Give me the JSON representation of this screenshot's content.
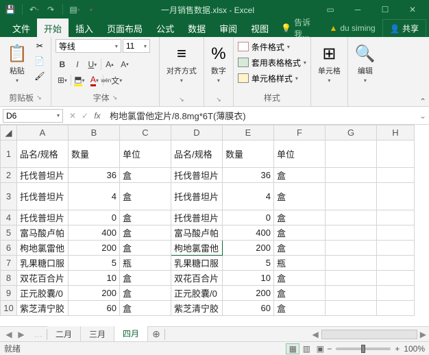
{
  "title": "一月销售数据.xlsx - Excel",
  "tabs": [
    "文件",
    "开始",
    "插入",
    "页面布局",
    "公式",
    "数据",
    "审阅",
    "视图"
  ],
  "tellme": "告诉我...",
  "user": "du siming",
  "share": "共享",
  "ribbon": {
    "clipboard": {
      "paste": "粘贴",
      "label": "剪贴板"
    },
    "font": {
      "name": "等线",
      "size": "11",
      "label": "字体"
    },
    "align": {
      "label": "对齐方式"
    },
    "number": {
      "label": "数字",
      "pct": "%"
    },
    "styles": {
      "cond": "条件格式",
      "table": "套用表格格式",
      "cell": "单元格样式",
      "label": "样式"
    },
    "cells": {
      "label": "单元格"
    },
    "editing": {
      "label": "编辑"
    }
  },
  "namebox": "D6",
  "formula": "枸地氯雷他定片/8.8mg*6T(薄膜衣)",
  "cols": [
    "A",
    "B",
    "C",
    "D",
    "E",
    "F",
    "G",
    "H"
  ],
  "headers": {
    "name": "品名/规格",
    "qty": "数量",
    "unit": "单位"
  },
  "data": [
    {
      "r": 2,
      "n": "托伐普坦片",
      "q": 36,
      "u": "盒"
    },
    {
      "r": 3,
      "n": "托伐普坦片",
      "q": 4,
      "u": "盒"
    },
    {
      "r": 4,
      "n": "托伐普坦片",
      "q": 0,
      "u": "盒"
    },
    {
      "r": 5,
      "n": "富马酸卢帕",
      "q": 400,
      "u": "盒"
    },
    {
      "r": 6,
      "n": "枸地氯雷他",
      "q": 200,
      "u": "盒"
    },
    {
      "r": 7,
      "n": "乳果糖口服",
      "q": 5,
      "u": "瓶"
    },
    {
      "r": 8,
      "n": "双花百合片",
      "q": 10,
      "u": "盒"
    },
    {
      "r": 9,
      "n": "正元胶囊/0",
      "q": 200,
      "u": "盒"
    },
    {
      "r": 10,
      "n": "紫芝清宁胶",
      "q": 60,
      "u": "盒"
    }
  ],
  "sheets": [
    "二月",
    "三月",
    "四月"
  ],
  "status": "就绪",
  "zoom": "100%"
}
